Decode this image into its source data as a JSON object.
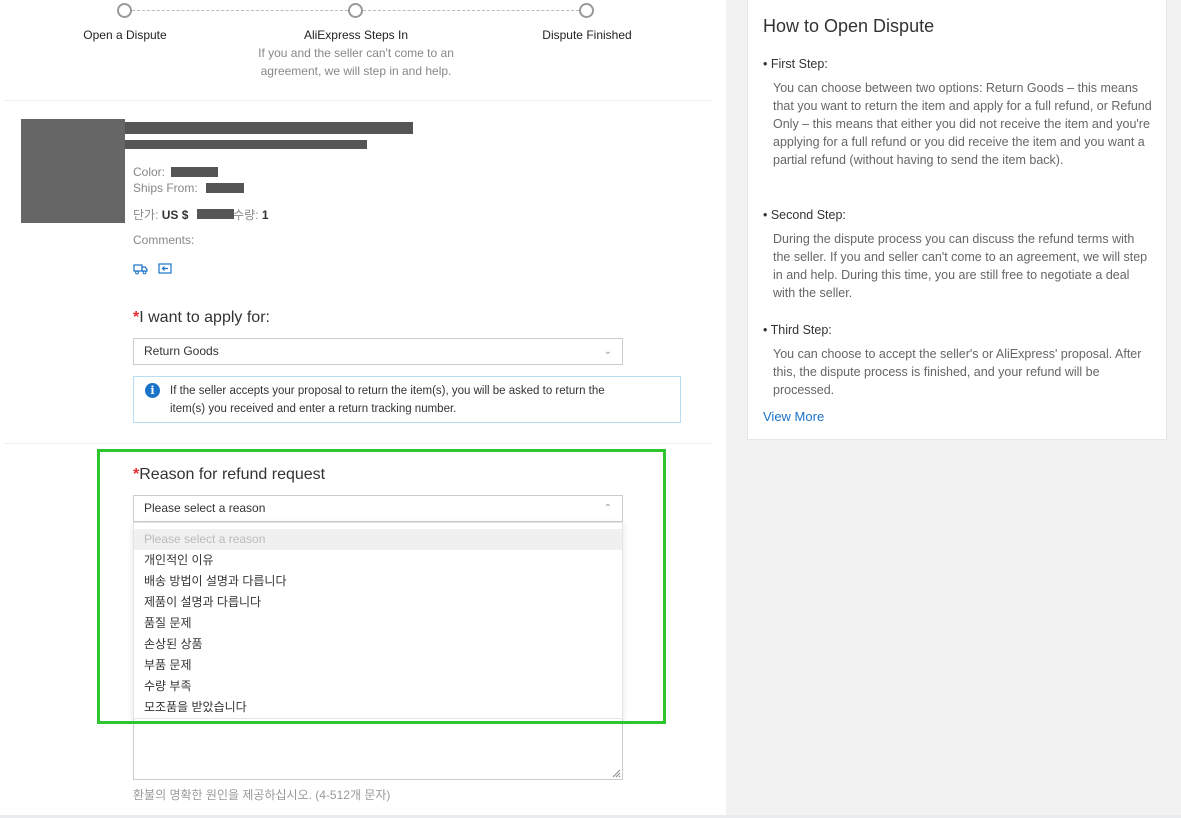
{
  "steps": [
    {
      "label": "Open a Dispute"
    },
    {
      "label": "AliExpress Steps In",
      "description": "If you and the seller can't come to an agreement, we will step in and help."
    },
    {
      "label": "Dispute Finished"
    }
  ],
  "product": {
    "color_label": "Color:",
    "ships_from_label": "Ships From:",
    "unit_price_label": "단가:",
    "currency": "US $",
    "quantity_label": "수량:",
    "quantity": "1",
    "comments_label": "Comments:"
  },
  "apply": {
    "required_mark": "*",
    "title": "I want to apply for:",
    "selected": "Return Goods",
    "info": "If the seller accepts your proposal to return the item(s), you will be asked to return the item(s) you received and enter a return tracking number."
  },
  "reason": {
    "required_mark": "*",
    "title": "Reason for refund request",
    "selected": "Please select a reason",
    "options": [
      "Please select a reason",
      "개인적인 이유",
      "배송 방법이 설명과 다릅니다",
      "제품이 설명과 다릅니다",
      "품질 문제",
      "손상된 상품",
      "부품 문제",
      "수량 부족",
      "모조품을 받았습니다"
    ],
    "hint": "환불의 명확한 원인을 제공하십시오. (4-512개 문자)"
  },
  "guide": {
    "title": "How to Open Dispute",
    "steps": [
      {
        "heading": "• First Step:",
        "text": "You can choose between two options: Return Goods – this means that you want to return the item and apply for a full refund, or Refund Only – this means that either you did not receive the item and you're applying for a full refund or you did receive the item and you want a partial refund (without having to send the item back)."
      },
      {
        "heading": "• Second Step:",
        "text": "During the dispute process you can discuss the refund terms with the seller. If you and seller can't come to an agreement, we will step in and help. During this time, you are still free to negotiate a deal with the seller."
      },
      {
        "heading": "• Third Step:",
        "text": "You can choose to accept the seller's or AliExpress' proposal. After this, the dispute process is finished, and your refund will be processed."
      }
    ],
    "view_more": "View More"
  },
  "colors": {
    "accent": "#1a73c9",
    "required": "#e62e2e",
    "highlight": "#2fc52f"
  }
}
